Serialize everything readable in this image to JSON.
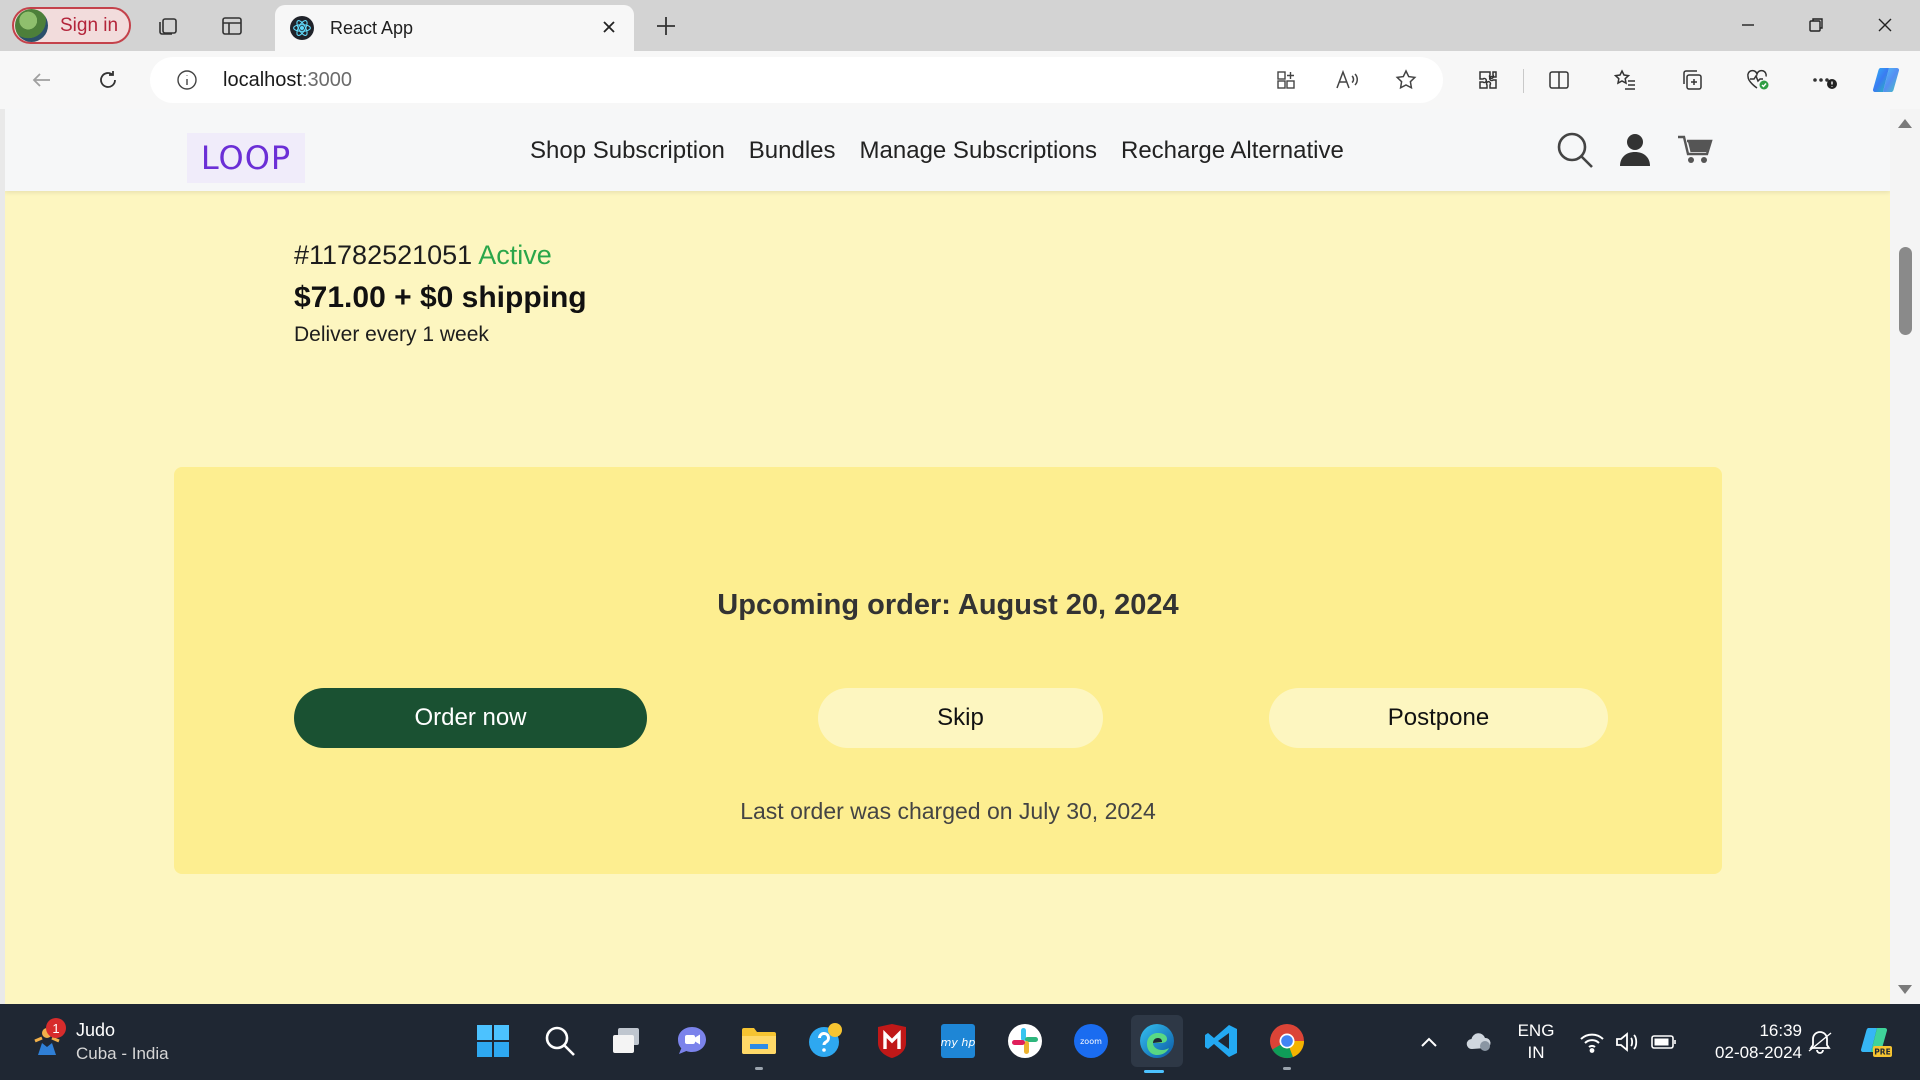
{
  "browser": {
    "profile_label": "Sign in",
    "tab_title": "React App",
    "url_host": "localhost",
    "url_port": ":3000"
  },
  "site": {
    "logo": "LOOP",
    "nav": [
      "Shop Subscription",
      "Bundles",
      "Manage Subscriptions",
      "Recharge Alternative"
    ]
  },
  "subscription": {
    "id": "#11782521051",
    "status": "Active",
    "price": "$71.00 + $0 shipping",
    "frequency": "Deliver every 1 week"
  },
  "order": {
    "upcoming": "Upcoming order: August 20, 2024",
    "order_now_label": "Order now",
    "skip_label": "Skip",
    "postpone_label": "Postpone",
    "last_order": "Last order was charged on July 30, 2024"
  },
  "taskbar": {
    "weather_title": "Judo",
    "weather_subtitle": "Cuba - India",
    "weather_badge": "1",
    "lang_top": "ENG",
    "lang_bottom": "IN",
    "time": "16:39",
    "date": "02-08-2024"
  },
  "colors": {
    "page_bg": "#fdf6c0",
    "card_bg": "#fdee90",
    "primary_button": "#1a5132",
    "status_active": "#2aa64a",
    "logo": "#6b2fd6"
  }
}
